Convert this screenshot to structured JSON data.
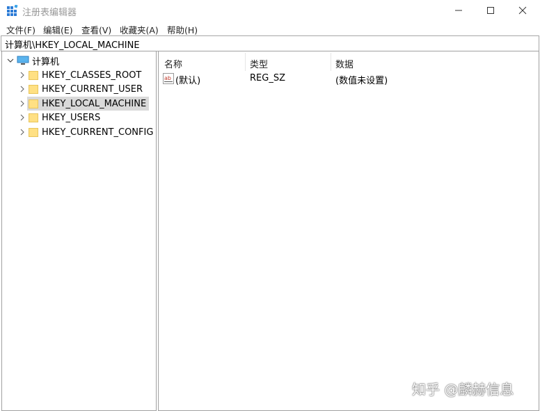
{
  "window": {
    "title": "注册表编辑器"
  },
  "menu": [
    "文件(F)",
    "编辑(E)",
    "查看(V)",
    "收藏夹(A)",
    "帮助(H)"
  ],
  "address": "计算机\\HKEY_LOCAL_MACHINE",
  "tree": {
    "root": "计算机",
    "hives": [
      "HKEY_CLASSES_ROOT",
      "HKEY_CURRENT_USER",
      "HKEY_LOCAL_MACHINE",
      "HKEY_USERS",
      "HKEY_CURRENT_CONFIG"
    ],
    "selected": "HKEY_LOCAL_MACHINE"
  },
  "list": {
    "columns": [
      "名称",
      "类型",
      "数据"
    ],
    "rows": [
      {
        "name": "(默认)",
        "type": "REG_SZ",
        "data": "(数值未设置)"
      }
    ]
  },
  "watermark": "知乎 @麟赫信息"
}
